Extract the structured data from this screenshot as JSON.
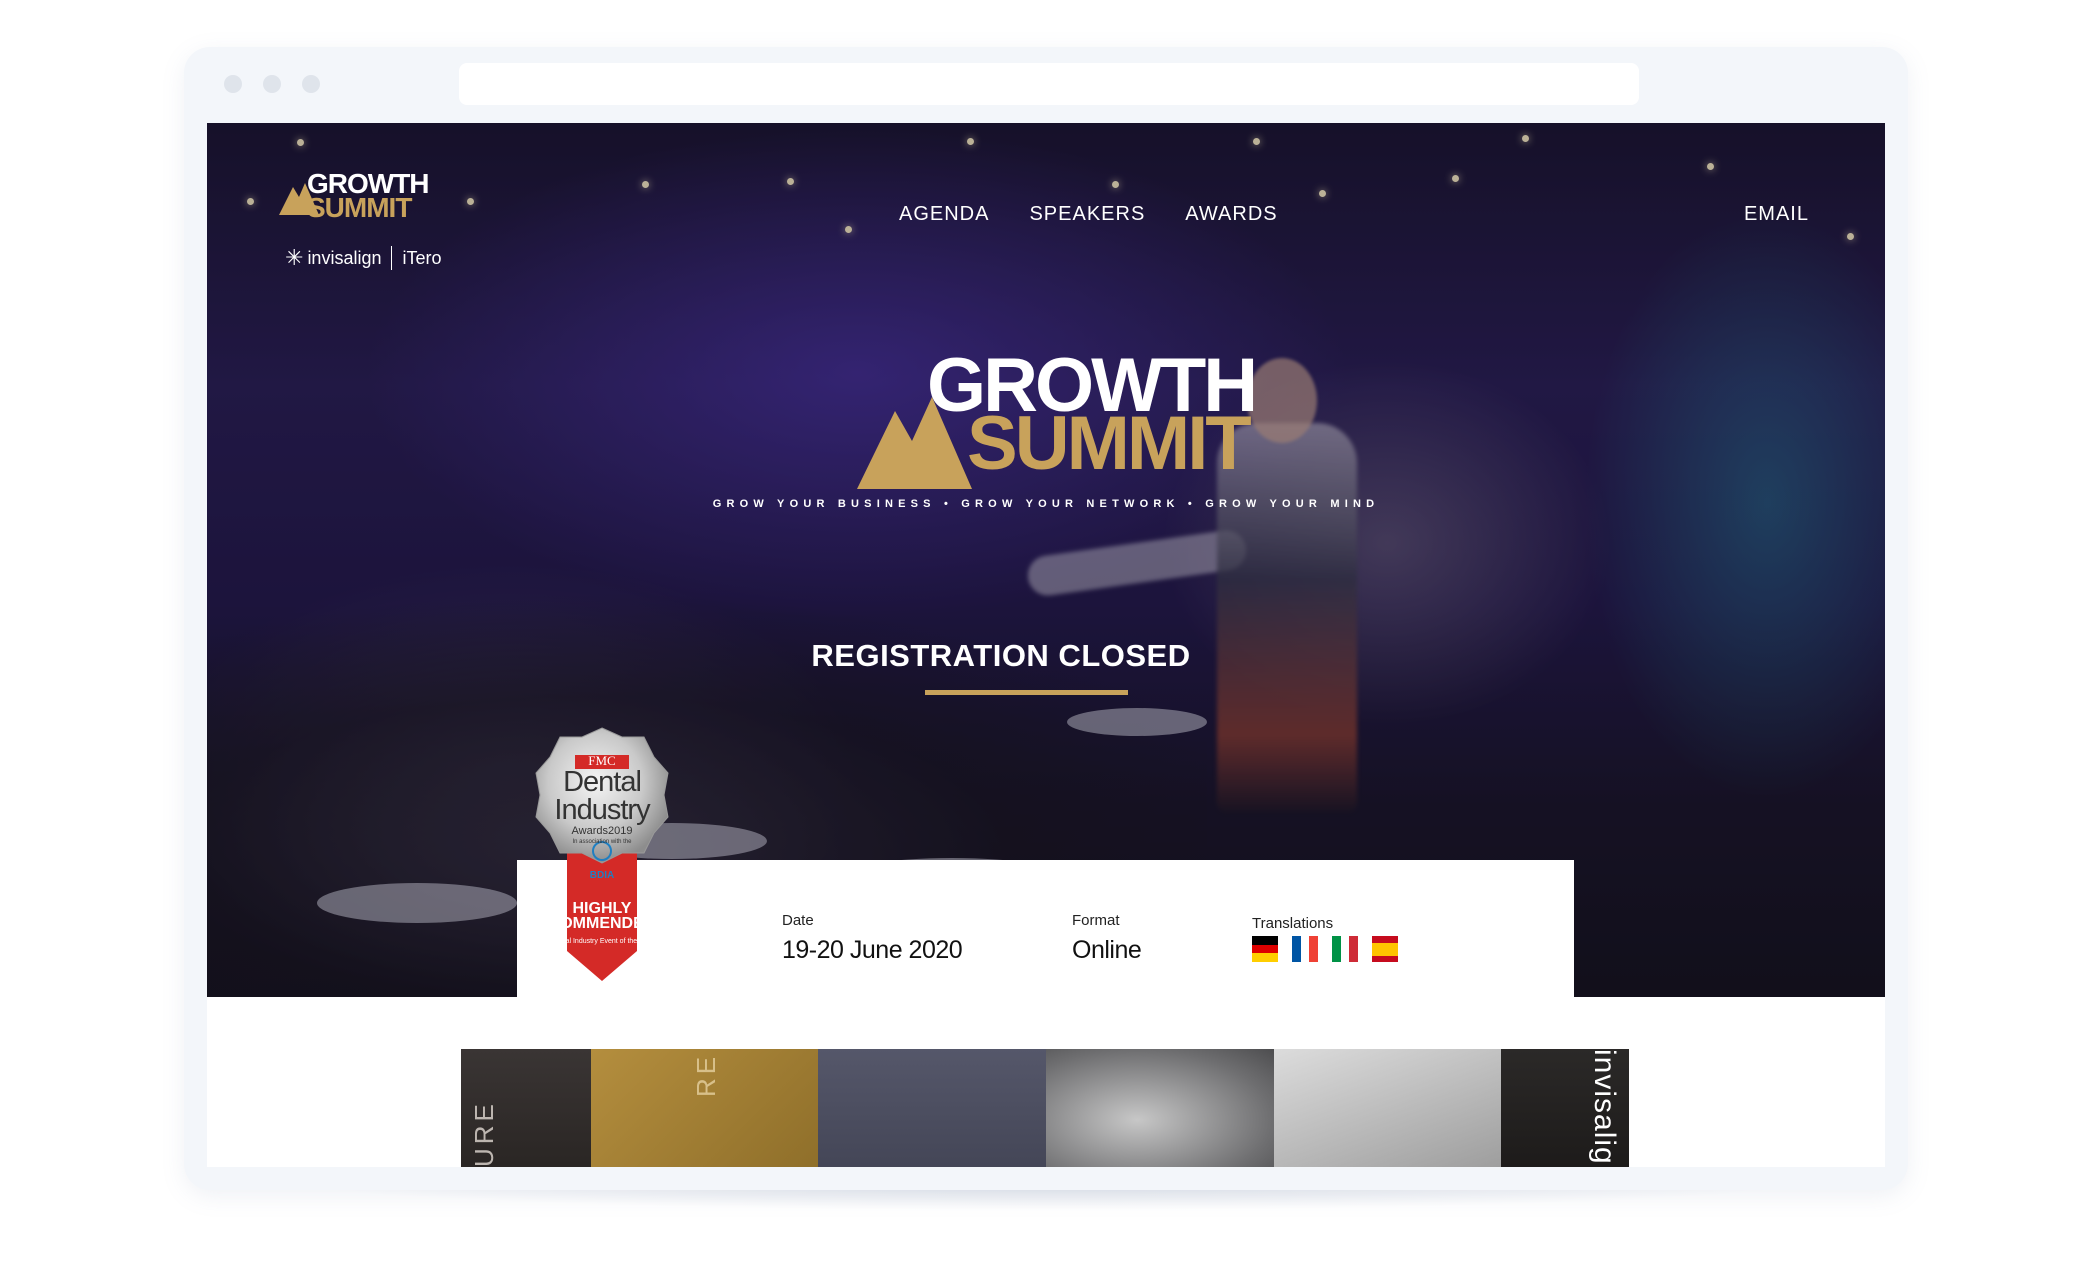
{
  "site": {
    "logo_small": {
      "line1": "GROWTH",
      "line2": "SUMMIT"
    },
    "partners": {
      "left": "invisalign",
      "right": "iTero"
    },
    "nav": {
      "links": [
        {
          "label": "AGENDA"
        },
        {
          "label": "SPEAKERS"
        },
        {
          "label": "AWARDS"
        }
      ],
      "email": "EMAIL"
    },
    "hero": {
      "logo": {
        "line1": "GROWTH",
        "line2": "SUMMIT"
      },
      "tagline": "GROW YOUR BUSINESS • GROW YOUR NETWORK • GROW YOUR MIND",
      "status": "REGISTRATION CLOSED"
    },
    "badge": {
      "brand": "FMC",
      "title": "Dental Industry",
      "awards": "Awards2019",
      "assoc": "In association with the",
      "org": "BDIA",
      "result": "HIGHLY COMMENDED",
      "category": "Dental Industry Event of the Year"
    },
    "info": {
      "date_label": "Date",
      "date_value": "19-20 June 2020",
      "format_label": "Format",
      "format_value": "Online",
      "translations_label": "Translations",
      "translations": [
        "de-flag-icon",
        "fr-flag-icon",
        "it-flag-icon",
        "es-flag-icon"
      ]
    },
    "strip": {
      "tile1_text": "URE",
      "tile2_text": "RE",
      "tile6_text": "invisalig"
    },
    "colors": {
      "gold": "#c8a25b",
      "badge_red": "#d42a27"
    }
  }
}
